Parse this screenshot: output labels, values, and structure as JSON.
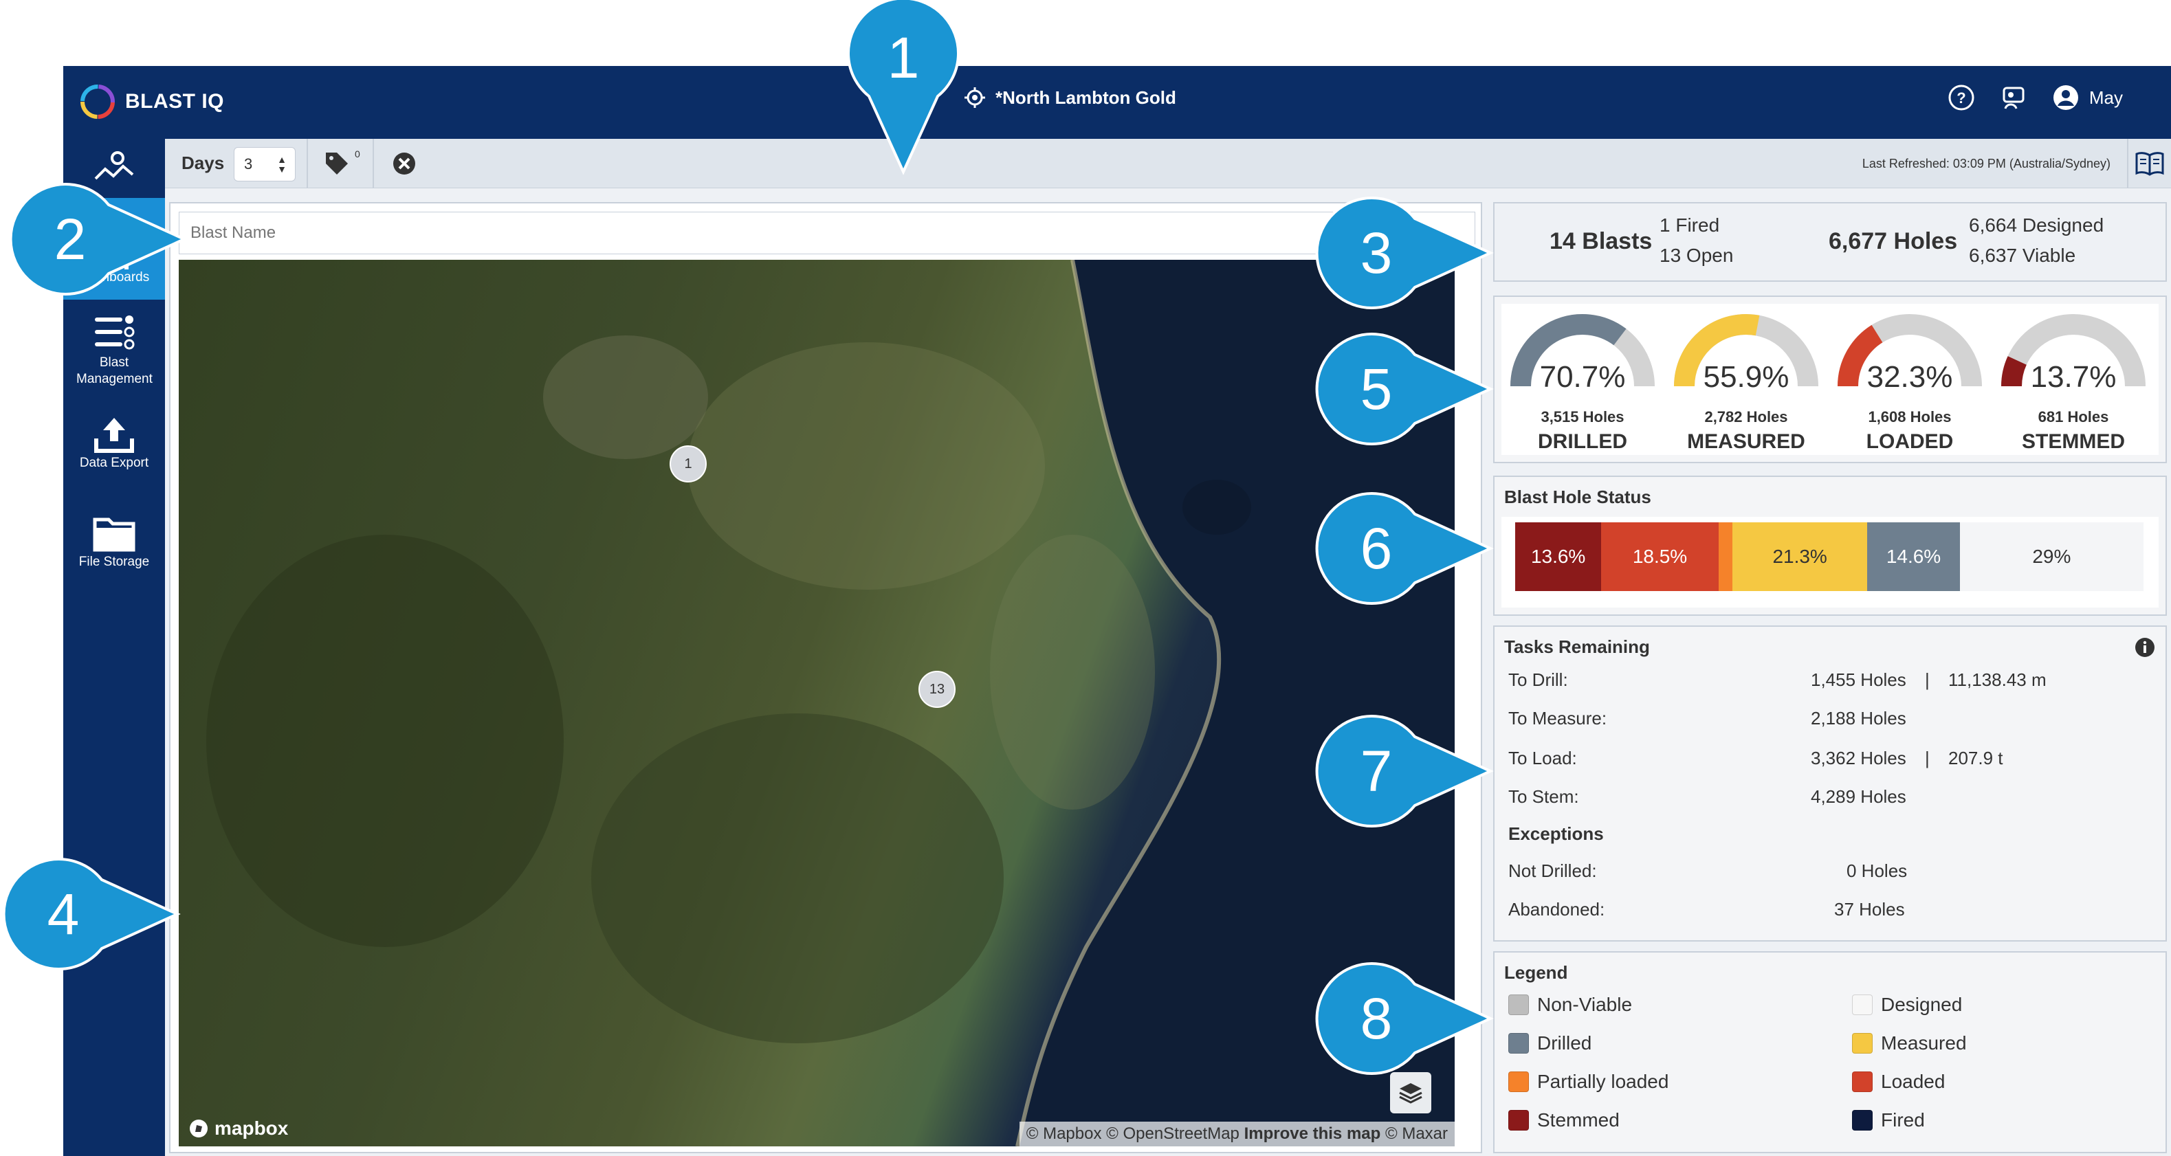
{
  "app": {
    "brand": "BLAST IQ",
    "site_name": "*North Lambton Gold",
    "user_name": "May"
  },
  "sidebar": {
    "items": [
      {
        "label": "Dashboards"
      },
      {
        "label": "Blast Management"
      },
      {
        "label": "Data Export"
      },
      {
        "label": "File Storage"
      }
    ]
  },
  "toolbar": {
    "days_label": "Days",
    "days_value": "3",
    "tag_count": "0",
    "last_refreshed": "Last Refreshed: 03:09 PM (Australia/Sydney)"
  },
  "map": {
    "search_placeholder": "Blast Name",
    "clusters": [
      "1",
      "13"
    ],
    "mapbox_label": "mapbox",
    "attribution_prefix": "© Mapbox © OpenStreetMap",
    "attribution_link": "Improve this map",
    "attribution_suffix": "© Maxar"
  },
  "summary": {
    "blasts": "14 Blasts",
    "fired": "1 Fired",
    "open": "13 Open",
    "holes": "6,677 Holes",
    "designed": "6,664 Designed",
    "viable": "6,637 Viable"
  },
  "gauges": [
    {
      "pct": "70.7%",
      "fraction": 0.707,
      "holes": "3,515 Holes",
      "label": "DRILLED",
      "color": "#6e7f8f"
    },
    {
      "pct": "55.9%",
      "fraction": 0.559,
      "holes": "2,782 Holes",
      "label": "MEASURED",
      "color": "#f5c842"
    },
    {
      "pct": "32.3%",
      "fraction": 0.323,
      "holes": "1,608 Holes",
      "label": "LOADED",
      "color": "#d2422a"
    },
    {
      "pct": "13.7%",
      "fraction": 0.137,
      "holes": "681 Holes",
      "label": "STEMMED",
      "color": "#8b1a1a"
    }
  ],
  "hole_status": {
    "title": "Blast Hole Status",
    "segments": [
      {
        "label": "13.6%",
        "fraction": 0.136,
        "color": "#8b1a1a",
        "text_color": "#ffffff"
      },
      {
        "label": "18.5%",
        "fraction": 0.185,
        "color": "#d2422a",
        "text_color": "#ffffff"
      },
      {
        "label": "",
        "fraction": 0.022,
        "color": "#f5822a",
        "text_color": "#ffffff"
      },
      {
        "label": "21.3%",
        "fraction": 0.213,
        "color": "#f5c842",
        "text_color": "#333333"
      },
      {
        "label": "14.6%",
        "fraction": 0.146,
        "color": "#6e7f8f",
        "text_color": "#ffffff"
      },
      {
        "label": "29%",
        "fraction": 0.29,
        "color": "#f4f5f7",
        "text_color": "#333333"
      }
    ]
  },
  "tasks": {
    "title": "Tasks Remaining",
    "rows": [
      {
        "label": "To Drill:",
        "value": "1,455 Holes",
        "extra": "11,138.43 m"
      },
      {
        "label": "To Measure:",
        "value": "2,188 Holes",
        "extra": ""
      },
      {
        "label": "To Load:",
        "value": "3,362 Holes",
        "extra": "207.9 t"
      },
      {
        "label": "To Stem:",
        "value": "4,289 Holes",
        "extra": ""
      }
    ],
    "exceptions_title": "Exceptions",
    "exceptions": [
      {
        "label": "Not Drilled:",
        "value": "0 Holes"
      },
      {
        "label": "Abandoned:",
        "value": "37 Holes"
      }
    ],
    "separator": "|"
  },
  "legend": {
    "title": "Legend",
    "items": [
      {
        "label": "Non-Viable",
        "color": "#bdbdbd"
      },
      {
        "label": "Designed",
        "color": "#f7f7f7"
      },
      {
        "label": "Drilled",
        "color": "#6e7f8f"
      },
      {
        "label": "Measured",
        "color": "#f5c842"
      },
      {
        "label": "Partially loaded",
        "color": "#f5822a"
      },
      {
        "label": "Loaded",
        "color": "#d2422a"
      },
      {
        "label": "Stemmed",
        "color": "#8b1a1a"
      },
      {
        "label": "Fired",
        "color": "#0d1b3e"
      }
    ]
  },
  "callouts": [
    "1",
    "2",
    "3",
    "4",
    "5",
    "6",
    "7",
    "8"
  ],
  "colors": {
    "nav": "#0b2d66",
    "accent": "#1a8fd6",
    "callout": "#1a95d3"
  }
}
